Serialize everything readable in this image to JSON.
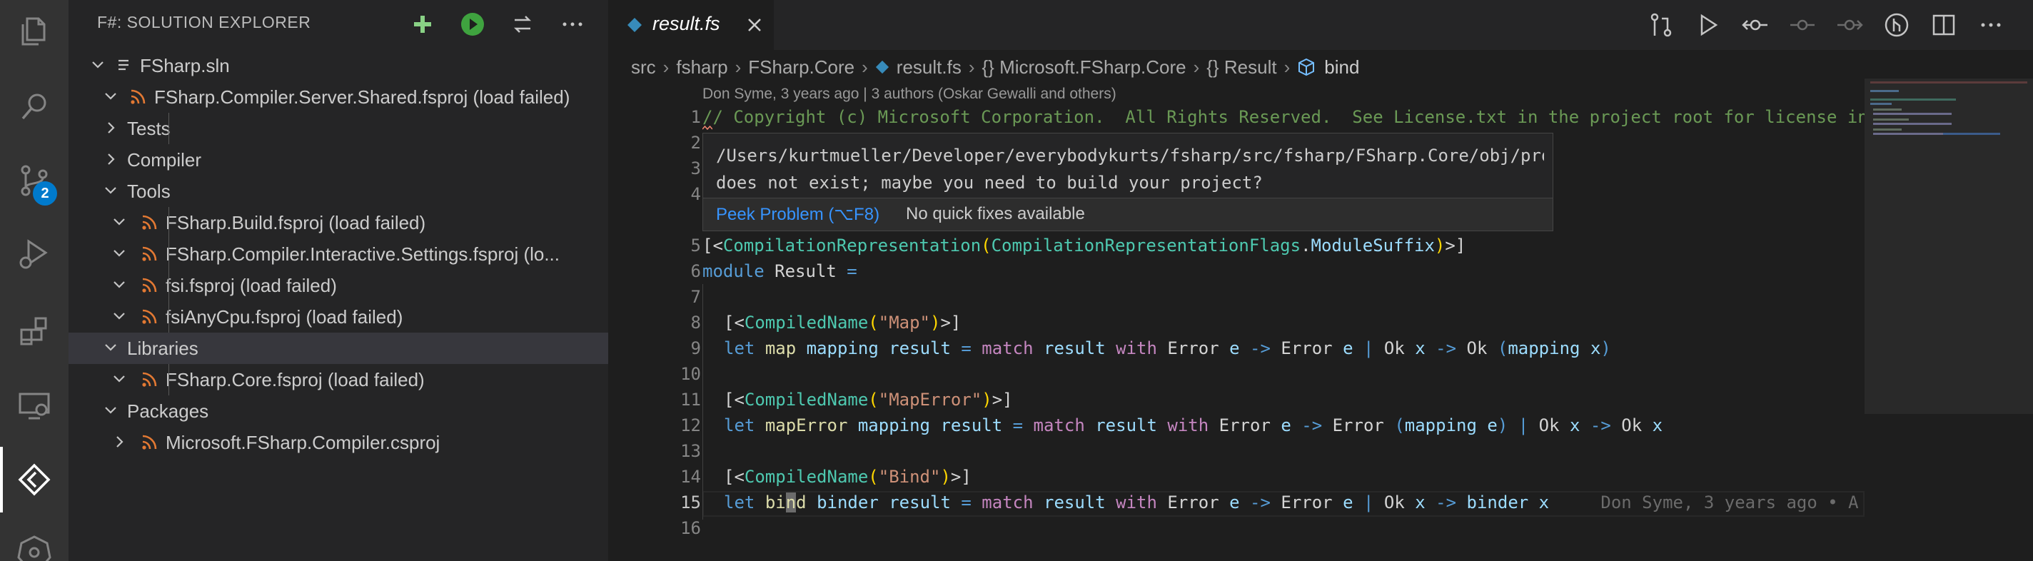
{
  "activity_bar": {
    "icons": [
      "explorer-icon",
      "search-icon",
      "source-control-icon",
      "run-debug-icon",
      "extensions-icon",
      "remote-explorer-icon",
      "ionide-fsharp-icon",
      "kubernetes-icon"
    ],
    "scm_badge": "2"
  },
  "sidebar": {
    "title": "F#: SOLUTION EXPLORER",
    "actions": [
      "add-icon",
      "run-icon",
      "refresh-icon",
      "more-icon"
    ],
    "items": [
      {
        "label": "FSharp.sln",
        "depth": 0,
        "expanded": true,
        "icon": "solution-file-icon"
      },
      {
        "label": "FSharp.Compiler.Server.Shared.fsproj (load failed)",
        "depth": 1,
        "expanded": true,
        "icon": "rss-project-icon"
      },
      {
        "label": "Tests",
        "depth": 1,
        "expanded": false,
        "icon": ""
      },
      {
        "label": "Compiler",
        "depth": 1,
        "expanded": false,
        "icon": ""
      },
      {
        "label": "Tools",
        "depth": 1,
        "expanded": true,
        "icon": ""
      },
      {
        "label": "FSharp.Build.fsproj (load failed)",
        "depth": 2,
        "expanded": true,
        "icon": "rss-project-icon"
      },
      {
        "label": "FSharp.Compiler.Interactive.Settings.fsproj (lo...",
        "depth": 2,
        "expanded": true,
        "icon": "rss-project-icon"
      },
      {
        "label": "fsi.fsproj (load failed)",
        "depth": 2,
        "expanded": true,
        "icon": "rss-project-icon"
      },
      {
        "label": "fsiAnyCpu.fsproj (load failed)",
        "depth": 2,
        "expanded": true,
        "icon": "rss-project-icon"
      },
      {
        "label": "Libraries",
        "depth": 1,
        "expanded": true,
        "icon": "",
        "selected": true
      },
      {
        "label": "FSharp.Core.fsproj (load failed)",
        "depth": 2,
        "expanded": true,
        "icon": "rss-project-icon"
      },
      {
        "label": "Packages",
        "depth": 1,
        "expanded": true,
        "icon": ""
      },
      {
        "label": "Microsoft.FSharp.Compiler.csproj",
        "depth": 2,
        "expanded": false,
        "icon": "rss-project-icon"
      }
    ]
  },
  "editor": {
    "tab": {
      "label": "result.fs"
    },
    "toolbar": [
      "open-changes-icon",
      "run-icon",
      "go-to-previous-icon",
      "go-to-commit-icon",
      "go-to-next-icon",
      "gitlens-icon",
      "split-editor-icon",
      "more-actions-icon"
    ],
    "breadcrumb": [
      "src",
      "fsharp",
      "FSharp.Core",
      "result.fs",
      "{} Microsoft.FSharp.Core",
      "{} Result",
      "bind"
    ],
    "blame_top": "Don Syme, 3 years ago | 3 authors (Oskar Gewalli and others)",
    "line_numbers": [
      "1",
      "2",
      "3",
      "4",
      "5",
      "6",
      "7",
      "8",
      "9",
      "10",
      "11",
      "12",
      "13",
      "14",
      "15",
      "16"
    ],
    "current_line": "15",
    "hover": {
      "message_line1": "/Users/kurtmueller/Developer/everybodykurts/fsharp/src/fsharp/FSharp.Core/obj/project.assets",
      "message_line2": "does not exist; maybe you need to build your project?",
      "peek_label": "Peek Problem (⌥F8)",
      "no_fixes_label": "No quick fixes available"
    },
    "code": {
      "l1": "// Copyright (c) Microsoft Corporation.  All Rights Reserved.  See License.txt in the project root for license in",
      "l5_a": "[<",
      "l5_b": "CompilationRepresentation",
      "l5_c": "(",
      "l5_d": "CompilationRepresentationFlags",
      "l5_e": ".",
      "l5_f": "ModuleSuffix",
      "l5_g": ")",
      "l5_h": ">]",
      "l6_kw": "module",
      "l6_name": " Result ",
      "l6_eq": "=",
      "l8_a": "[<",
      "l8_b": "CompiledName",
      "l8_c": "(",
      "l8_d": "\"Map\"",
      "l8_e": ")",
      "l8_f": ">]",
      "l11_d": "\"MapError\"",
      "l14_d": "\"Bind\"",
      "kw_let": "let",
      "kw_match": "match",
      "kw_with": "with",
      "op_arrow": "->",
      "op_pipe": "|",
      "op_eq": "=",
      "l9_fn": "map",
      "l12_fn": "mapError",
      "l15_fn_a": "bi",
      "l15_fn_b": "n",
      "l15_fn_c": "d",
      "p_mapping": "mapping",
      "p_binder": "binder",
      "p_result": "result",
      "p_e": "e",
      "p_x": "x",
      "c_error": "Error",
      "c_ok": "Ok",
      "lp": "(",
      "rp": ")",
      "blame_inline": "Don Syme, 3 years ago • A"
    }
  },
  "colors": {
    "accent": "#007acc",
    "add_green": "#89d185",
    "run_green": "#3fa33f",
    "rss_orange": "#e37933",
    "link_blue": "#3794ff",
    "error_red": "#f48771"
  }
}
